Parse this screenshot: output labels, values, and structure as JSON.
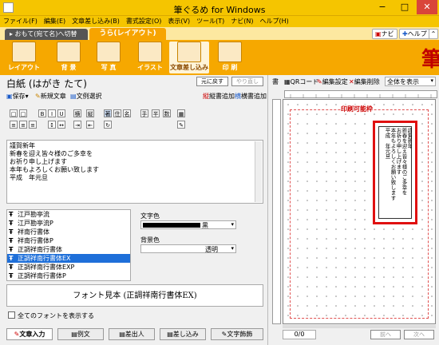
{
  "window": {
    "title": "筆ぐるめ for Windows"
  },
  "menu": [
    "ファイル(F)",
    "編集(E)",
    "文章差し込み(B)",
    "書式設定(O)",
    "表示(V)",
    "ツール(T)",
    "ナビ(N)",
    "ヘルプ(H)"
  ],
  "tabs": {
    "omote": "▸ おもて(宛て名)へ切替",
    "ura": "うら(レイアウト)"
  },
  "right_buttons": {
    "navi": "ナビ",
    "help": "ヘルプ"
  },
  "toolbar": [
    "レイアウト",
    "背 景",
    "写 真",
    "イラスト",
    "文章差し込み",
    "印 刷"
  ],
  "brand": "筆",
  "left": {
    "paper": "白紙 (はがき たて)",
    "undo": "元に戻す",
    "redo": "やり直し",
    "save": "保存",
    "new_text": "新規文章",
    "select_text": "文例選択",
    "vertical_add": "縦書追加",
    "horizontal_add": "横書追加",
    "fmt_row1": [
      "B",
      "I",
      "U",
      "横",
      "縦",
      "著",
      "住",
      "名",
      "手",
      "半",
      "数"
    ],
    "greeting_lines": [
      "謹賀新年",
      "新春を迎え皆々様のご多幸を",
      "お祈り申し上げます",
      "本年もよろしくお願い致します",
      "平成　年元旦"
    ],
    "fonts": [
      "江戸勘亭流",
      "江戸勘亭流P",
      "祥南行書体",
      "祥南行書体P",
      "正調祥南行書体",
      "正調祥南行書体EX",
      "正調祥南行書体EXP",
      "正調祥南行書体P"
    ],
    "selected_font_index": 5,
    "text_color_label": "文字色",
    "text_color_value": "黒",
    "bg_color_label": "背景色",
    "bg_color_value": "透明",
    "font_sample": "フォント見本 (正調祥南行書体EX)",
    "show_all_fonts": "全てのフォントを表示する",
    "bottom_tabs": [
      "文章入力",
      "例文",
      "差出人",
      "差し込み",
      "文字飾飾"
    ]
  },
  "right": {
    "display_label": "書",
    "qr_code": "QRコード",
    "edit_settings": "編集設定",
    "edit_delete": "編集削除",
    "view_select": "全体を表示",
    "printable_area": "印刷可能枠",
    "postcard_columns": [
      "謹賀新年",
      "新春を迎え皆々様のご多幸を",
      "お祈り申し上げます",
      "本年もよろしくお願い致します",
      "平成　年元旦"
    ],
    "page_counter": "0/0",
    "nav_prev": "前へ",
    "nav_next": "次へ"
  }
}
